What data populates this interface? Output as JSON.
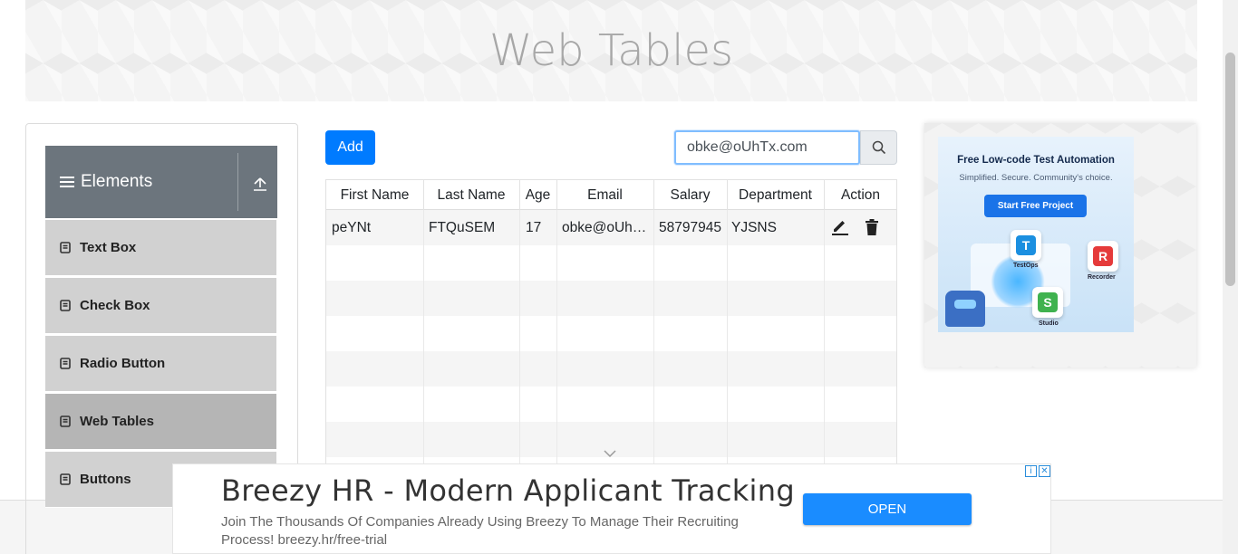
{
  "page": {
    "title": "Web Tables"
  },
  "sidebar": {
    "group_title": "Elements",
    "items": [
      {
        "label": "Text Box"
      },
      {
        "label": "Check Box"
      },
      {
        "label": "Radio Button"
      },
      {
        "label": "Web Tables",
        "active": true
      },
      {
        "label": "Buttons"
      }
    ]
  },
  "toolbar": {
    "add_label": "Add"
  },
  "search": {
    "value": "obke@oUhTx.com"
  },
  "table": {
    "headers": [
      "First Name",
      "Last Name",
      "Age",
      "Email",
      "Salary",
      "Department",
      "Action"
    ],
    "rows": [
      {
        "first_name": "peYNt",
        "last_name": "FTQuSEM",
        "age": "17",
        "email": "obke@oUh…",
        "salary": "58797945",
        "department": "YJSNS"
      }
    ]
  },
  "ad_right": {
    "headline": "Free Low-code Test Automation",
    "subline": "Simplified. Secure. Community's choice.",
    "cta": "Start Free Project",
    "apps": [
      "TestOps",
      "Recorder",
      "Studio"
    ]
  },
  "bottom_ad": {
    "headline": "Breezy HR - Modern Applicant Tracking",
    "body": "Join The Thousands Of Companies Already Using Breezy To Manage Their Recruiting Process! breezy.hr/free-trial",
    "button": "OPEN"
  },
  "colors": {
    "primary": "#007bff",
    "sidebar_header": "#6c757d",
    "menu_item": "#d1d1d1",
    "menu_active": "#b5b5b5"
  }
}
